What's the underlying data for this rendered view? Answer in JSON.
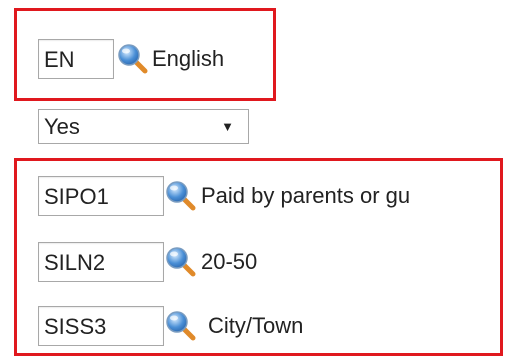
{
  "language": {
    "code": "EN",
    "label": "English",
    "icon": "search-icon"
  },
  "yes_no_select": {
    "selected": "Yes",
    "arrow": "▼"
  },
  "payment": {
    "code": "SIPO1",
    "label": "Paid by parents or gu",
    "icon": "search-icon"
  },
  "income": {
    "code": "SILN2",
    "label": "20-50",
    "icon": "search-icon"
  },
  "area": {
    "code": "SISS3",
    "label": "City/Town",
    "icon": "search-icon"
  },
  "colors": {
    "highlight_border": "#e0181e",
    "input_border": "#a8a8a8",
    "icon_blue": "#4a8fd6",
    "icon_handle": "#e08a2a"
  }
}
